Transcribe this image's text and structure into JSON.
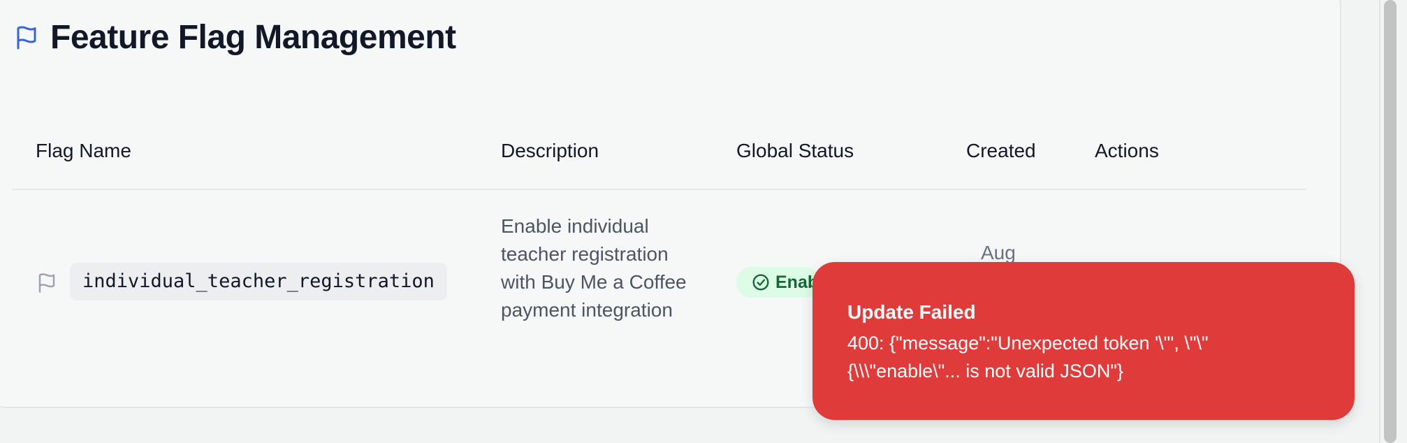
{
  "page": {
    "title": "Feature Flag Management"
  },
  "table": {
    "headers": {
      "flag_name": "Flag Name",
      "description": "Description",
      "global_status": "Global Status",
      "created": "Created",
      "actions": "Actions"
    },
    "rows": [
      {
        "flag_name": "individual_teacher_registration",
        "description": "Enable individual teacher registration with Buy Me a Coffee payment integration",
        "status": "Enab",
        "created": "Aug"
      }
    ]
  },
  "toast": {
    "title": "Update Failed",
    "message": "400: {\"message\":\"Unexpected token '\\\"', \\\"\\\"{\\\\\\\"enable\\\"... is not valid JSON\"}"
  },
  "colors": {
    "accent": "#3b63d6",
    "toast_bg": "#e03b3b",
    "status_bg": "#dcfce7",
    "status_text": "#166534"
  },
  "icons": {
    "title": "flag-icon",
    "row": "flag-icon",
    "status": "check-circle-icon"
  }
}
